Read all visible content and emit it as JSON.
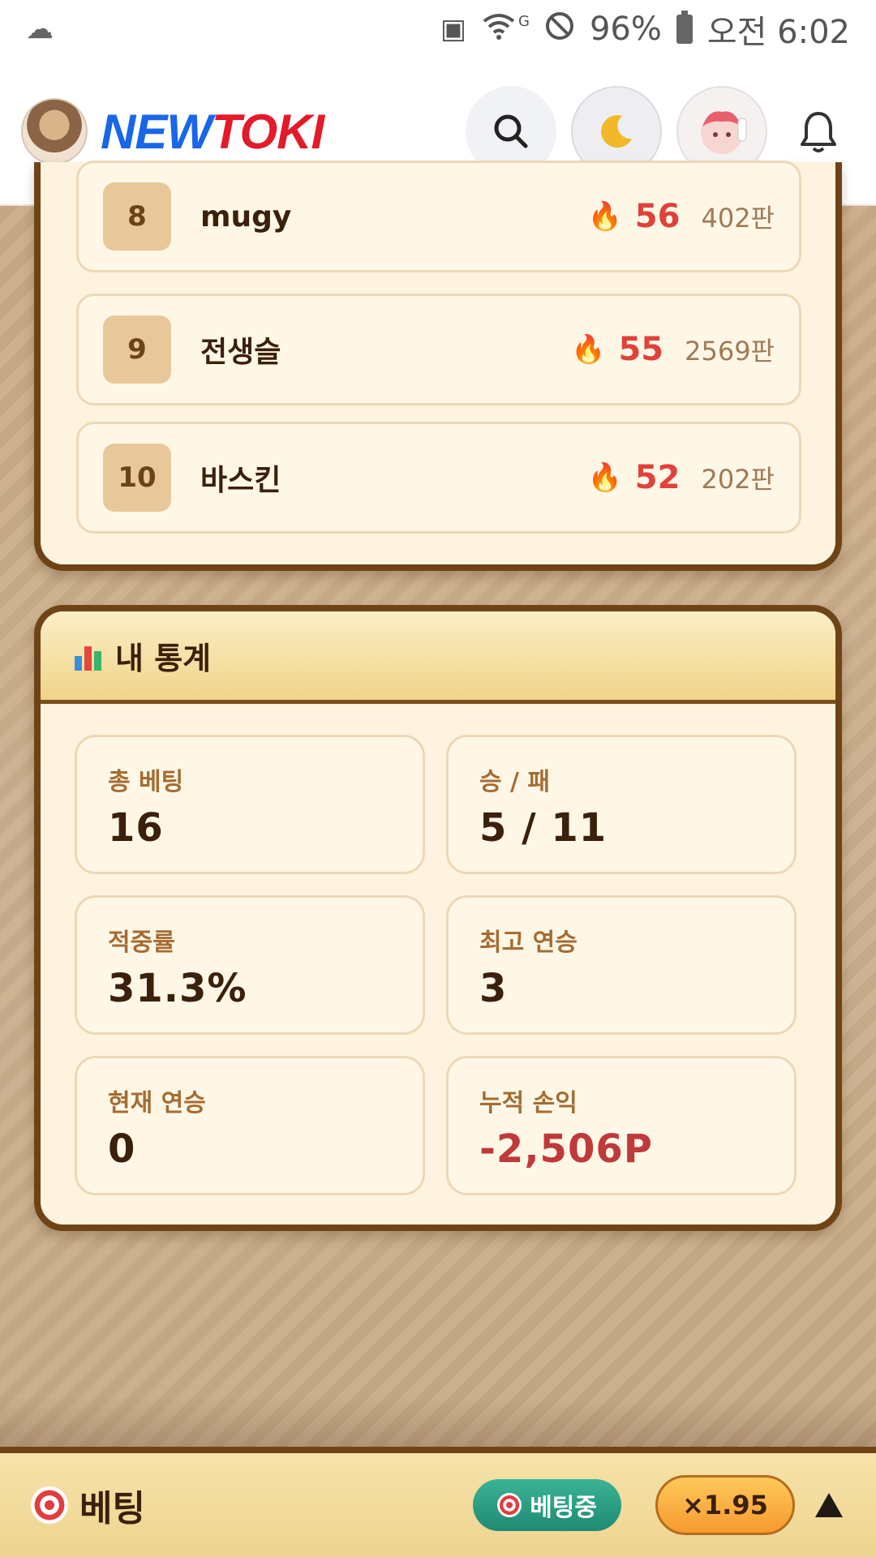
{
  "status_bar": {
    "battery_percent": "96%",
    "time": "오전 6:02",
    "network_badge": "G"
  },
  "header": {
    "logo_part1": "NEW",
    "logo_part2": "TOKI",
    "icons": [
      "search-icon",
      "moon-icon",
      "avatar",
      "bell-icon"
    ]
  },
  "ranking": {
    "rows": [
      {
        "rank": "8",
        "name": "mugy",
        "streak": "56",
        "games": "402판"
      },
      {
        "rank": "9",
        "name": "전생슬",
        "streak": "55",
        "games": "2569판"
      },
      {
        "rank": "10",
        "name": "바스킨",
        "streak": "52",
        "games": "202판"
      }
    ]
  },
  "stats": {
    "title": "내 통계",
    "items": [
      {
        "label": "총 베팅",
        "value": "16"
      },
      {
        "label": "승 / 패",
        "value": "5 / 11"
      },
      {
        "label": "적중률",
        "value": "31.3%"
      },
      {
        "label": "최고 연승",
        "value": "3"
      },
      {
        "label": "현재 연승",
        "value": "0"
      },
      {
        "label": "누적 손익",
        "value": "-2,506P"
      }
    ]
  },
  "bet_bar": {
    "title": "베팅",
    "status": "베팅중",
    "odds": "×1.95"
  },
  "colors": {
    "frame": "#6e4417",
    "accent_red": "#e0413a",
    "negative": "#c0393b",
    "status_green": "#1f8a72"
  }
}
